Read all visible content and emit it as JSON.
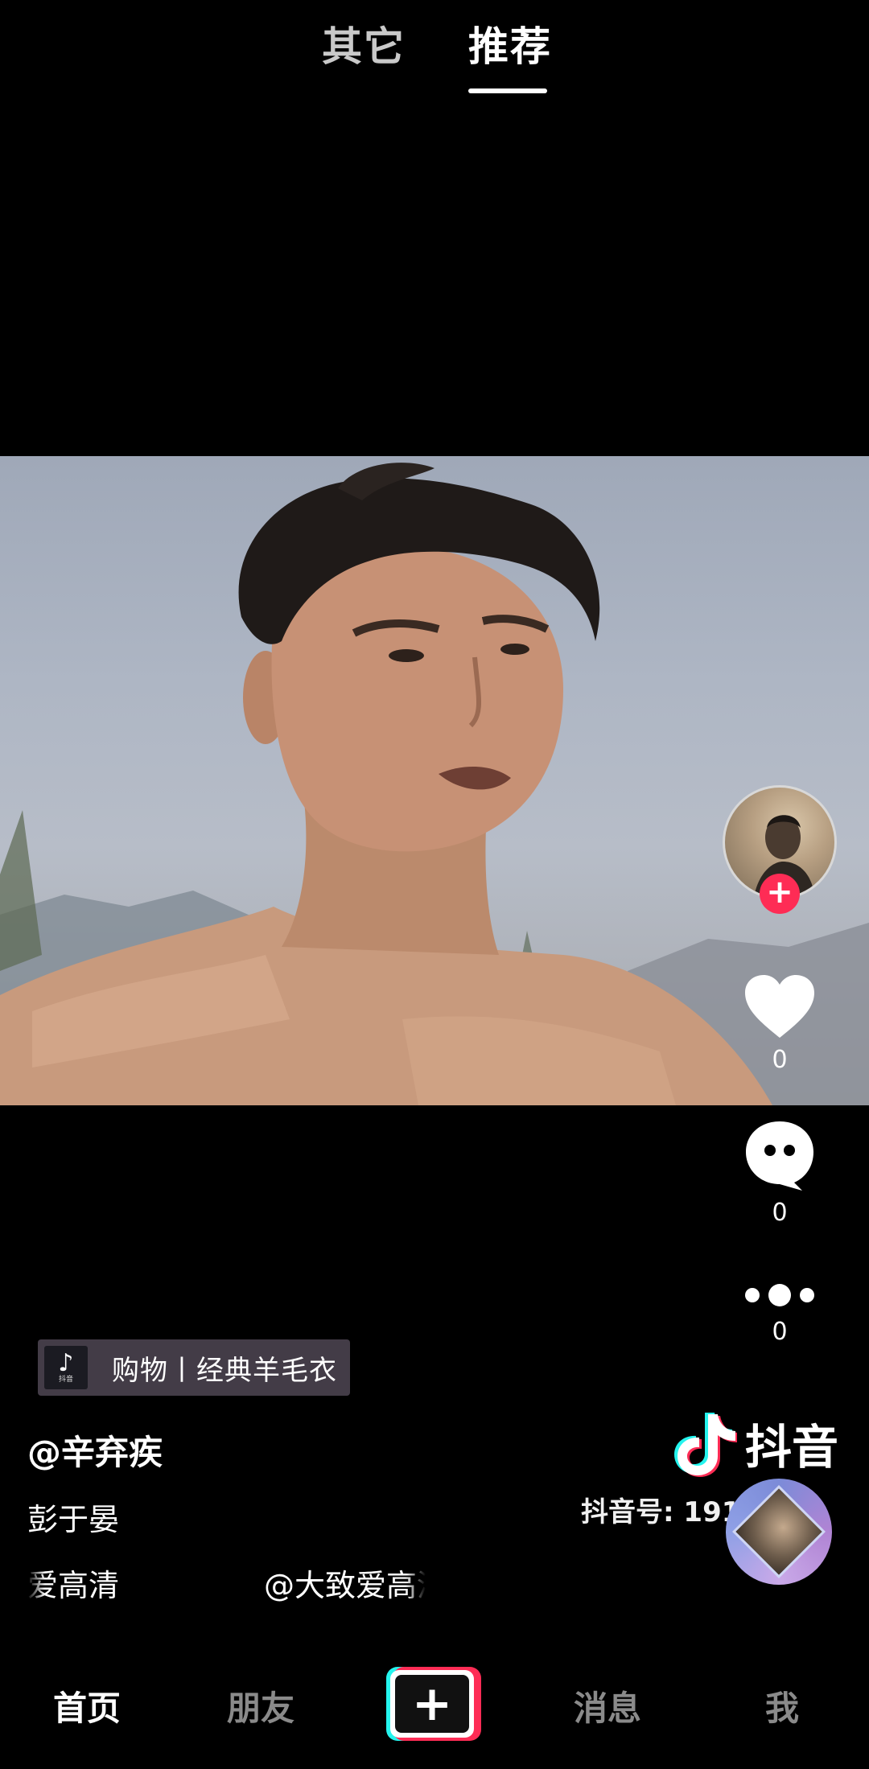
{
  "top_tabs": [
    {
      "label": "其它",
      "active": false
    },
    {
      "label": "推荐",
      "active": true
    }
  ],
  "actions": {
    "likes": "0",
    "comments": "0",
    "shares": "0"
  },
  "shop_tag": {
    "text": "购物丨经典羊毛衣",
    "logo_caption": "抖音"
  },
  "post": {
    "author": "@辛弃疾",
    "description_line1": "彭于晏",
    "description_line2_left": "爱高清",
    "description_line2_right": "@大致爱高清"
  },
  "watermark": {
    "brand": "抖音",
    "id": "抖音号: 191……3"
  },
  "bottom_nav": {
    "home": "首页",
    "friends": "朋友",
    "create": "+",
    "messages": "消息",
    "me": "我"
  },
  "colors": {
    "accent_red": "#fe2c55",
    "accent_cyan": "#25f4ee",
    "background": "#000000"
  },
  "icons": [
    "plus-icon",
    "heart-icon",
    "comment-icon",
    "more-dots-icon",
    "tiktok-note-icon"
  ]
}
